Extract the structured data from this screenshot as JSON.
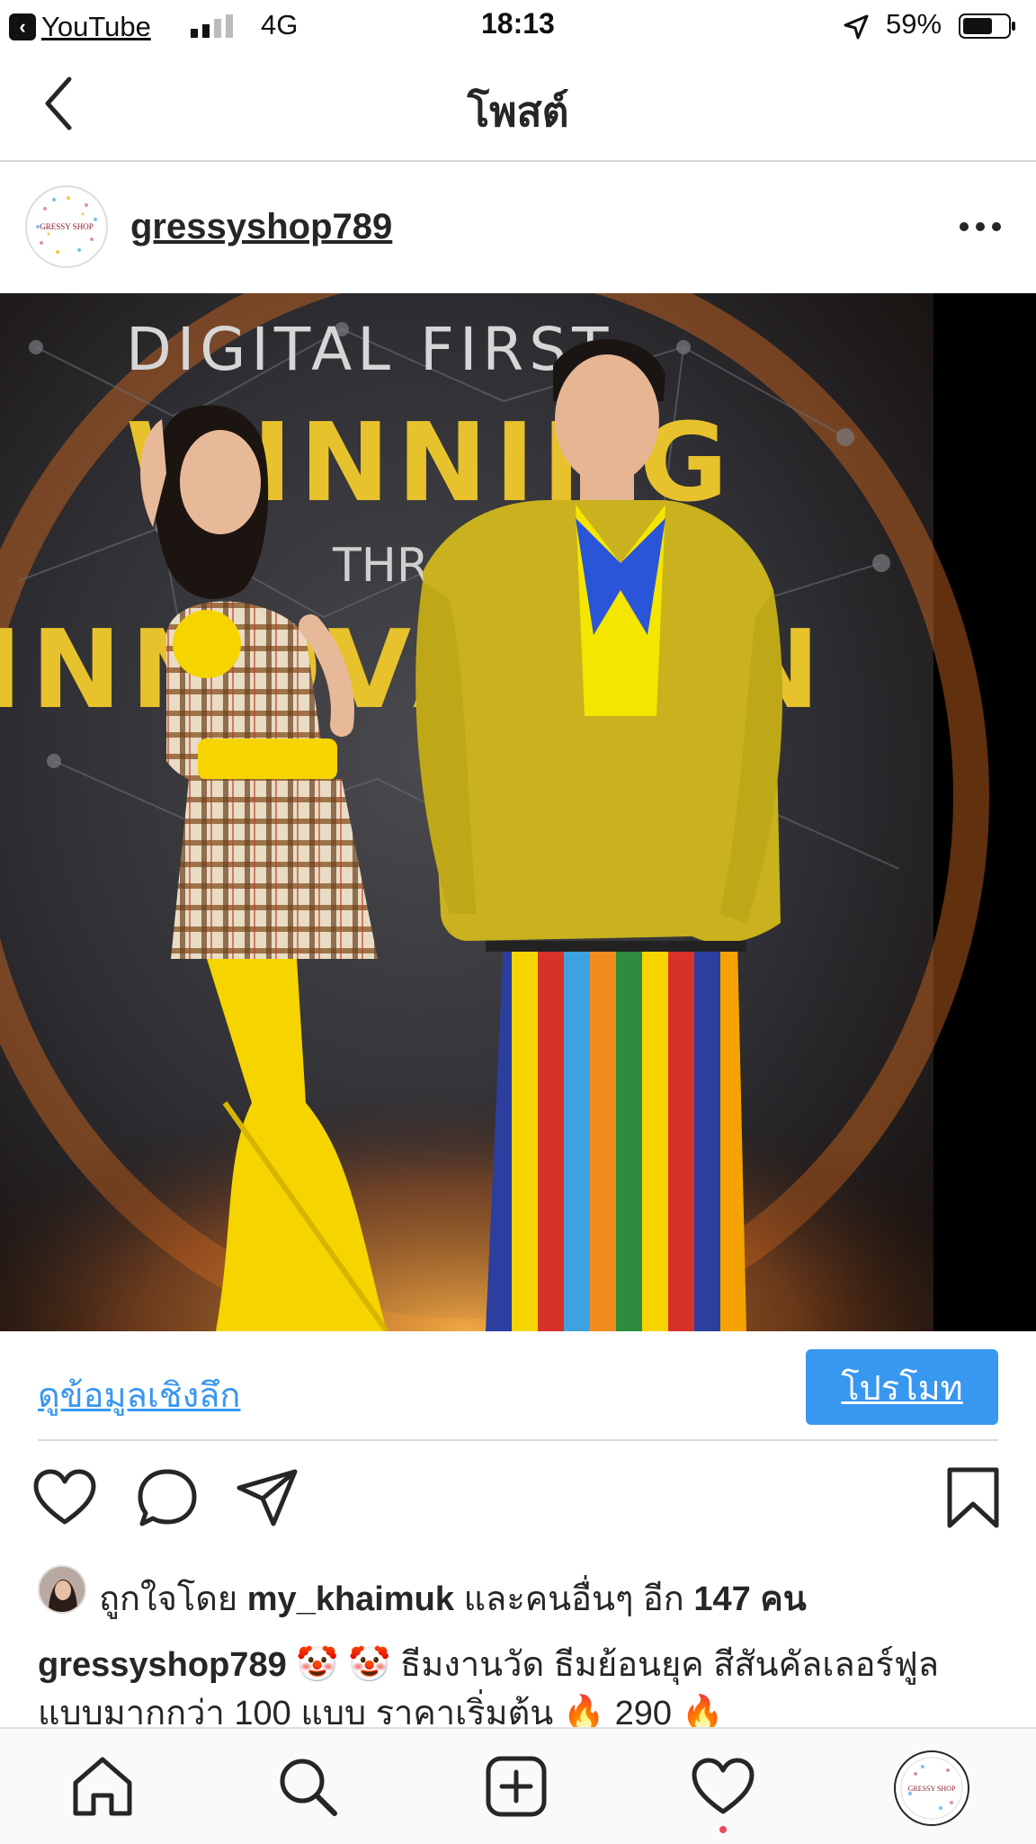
{
  "status_bar": {
    "back_app": "YouTube",
    "network": "4G",
    "time": "18:13",
    "battery": "59%",
    "icons": [
      "signal-icon",
      "location-arrow-icon",
      "battery-icon"
    ]
  },
  "header": {
    "title": "โพสต์",
    "back_icon": "chevron-left-icon"
  },
  "post": {
    "username": "gressyshop789",
    "avatar_text": "GRESSY SHOP",
    "more_icon": "ellipsis-icon",
    "photo_texts": {
      "line1": "DIGITAL FIRST",
      "line2": "WINNING",
      "line3": "THROUGH",
      "line4": "INNOVATION"
    }
  },
  "insights": {
    "view_insights": "ดูข้อมูลเชิงลึก",
    "promote": "โปรโมท"
  },
  "actions": [
    "heart-icon",
    "comment-icon",
    "share-icon",
    "bookmark-icon"
  ],
  "likes": {
    "prefix": "ถูกใจโดย",
    "user": "my_khaimuk",
    "suffix": "และคนอื่นๆ อีก",
    "count": "147",
    "unit": "คน"
  },
  "caption": {
    "user": "gressyshop789",
    "text": " 🤡 🤡 ธีมงานวัด ธีมย้อนยุค สีสันคัลเลอร์ฟูล แบบมากกว่า 100 แบบ ราคาเริ่มต้น 🔥 290 🔥"
  },
  "tabbar": [
    "home-icon",
    "search-icon",
    "new-post-icon",
    "activity-icon",
    "profile-icon"
  ],
  "colors": {
    "accent": "#3897f0",
    "notification": "#ed4956",
    "suit_yellow": "#c9b21d",
    "bright_yellow": "#f5d400"
  }
}
